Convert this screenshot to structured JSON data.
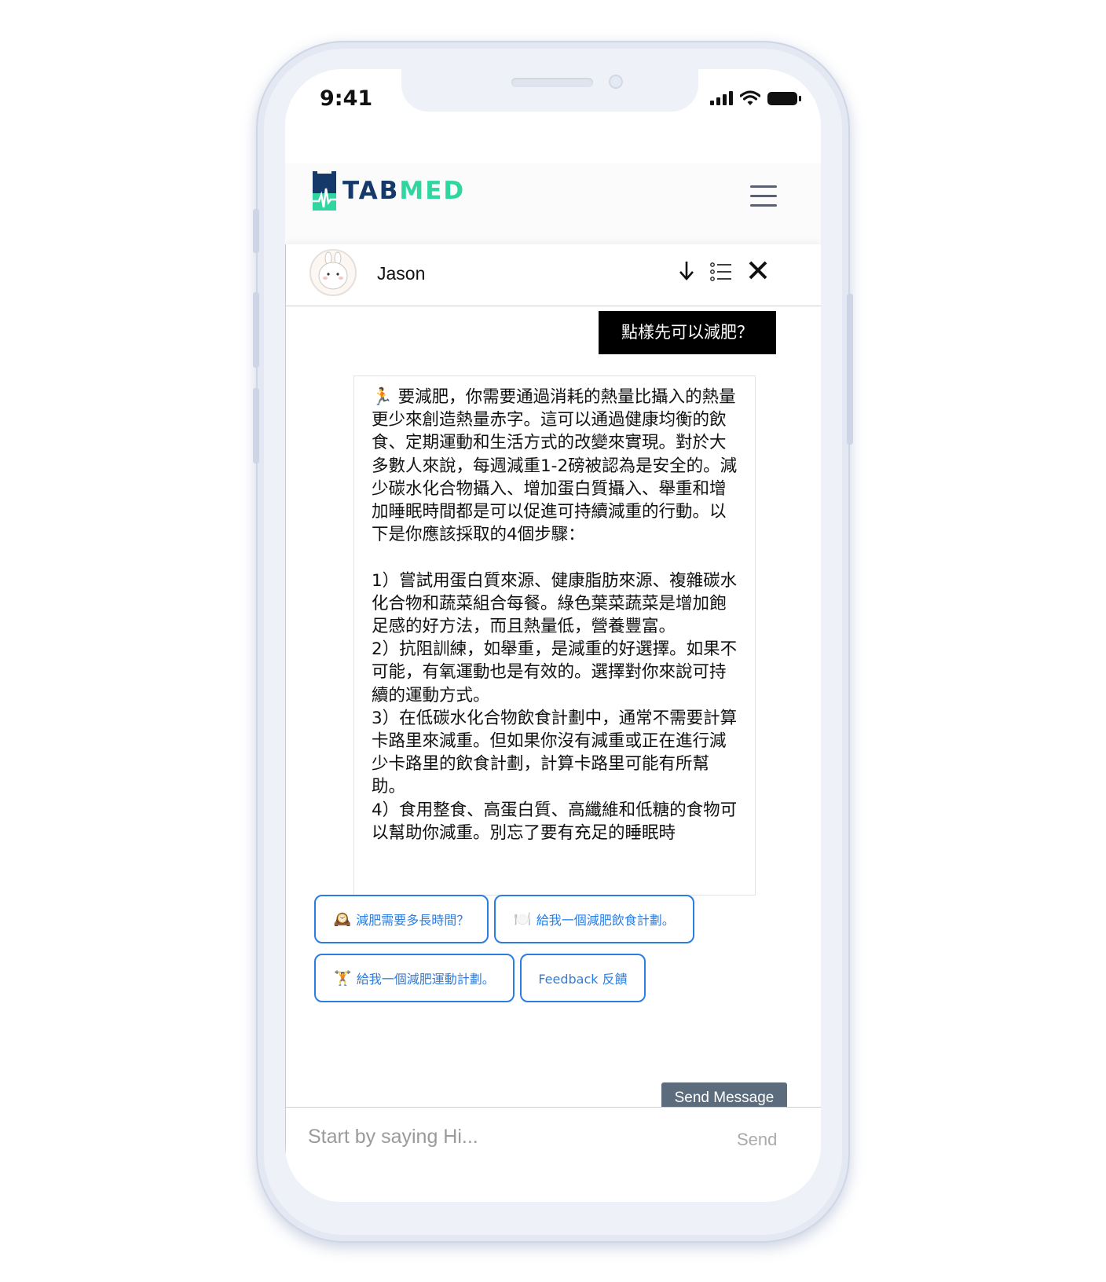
{
  "status_bar": {
    "time": "9:41"
  },
  "brand": {
    "logo_part1": "TAB",
    "logo_part2": "MED",
    "primary_color": "#153a6a",
    "accent_color": "#2fd6a0"
  },
  "chat": {
    "agent_name": "Jason",
    "user_message": "點樣先可以減肥？",
    "bot_message": "🏃 要減肥，你需要通過消耗的熱量比攝入的熱量更少來創造熱量赤字。這可以通過健康均衡的飲食、定期運動和生活方式的改變來實現。對於大多數人來說，每週減重1-2磅被認為是安全的。減少碳水化合物攝入、增加蛋白質攝入、舉重和增加睡眠時間都是可以促進可持續減重的行動。以下是你應該採取的4個步驟：\n\n1）嘗試用蛋白質來源、健康脂肪來源、複雜碳水化合物和蔬菜組合每餐。綠色葉菜蔬菜是增加飽足感的好方法，而且熱量低，營養豐富。\n2）抗阻訓練，如舉重，是減重的好選擇。如果不可能，有氧運動也是有效的。選擇對你來說可持續的運動方式。\n3）在低碳水化合物飲食計劃中，通常不需要計算卡路里來減重。但如果你沒有減重或正在進行減少卡路里的飲食計劃，計算卡路里可能有所幫助。\n4）食用整食、高蛋白質、高纖維和低糖的食物可以幫助你減重。別忘了要有充足的睡眠時",
    "quick_replies": [
      {
        "emoji": "🕰️",
        "label": "減肥需要多長時間？"
      },
      {
        "emoji": "🍽️",
        "label": "給我一個減肥飲食計劃。"
      },
      {
        "emoji": "🏋️",
        "label": "給我一個減肥運動計劃。"
      },
      {
        "emoji": "",
        "label": "Feedback 反饋"
      }
    ],
    "input_placeholder": "Start by saying Hi...",
    "send_label": "Send",
    "tooltip": "Send Message"
  },
  "icons": [
    "arrow-down-icon",
    "list-icon",
    "close-icon",
    "menu-icon",
    "signal-icon",
    "wifi-icon",
    "battery-icon"
  ]
}
